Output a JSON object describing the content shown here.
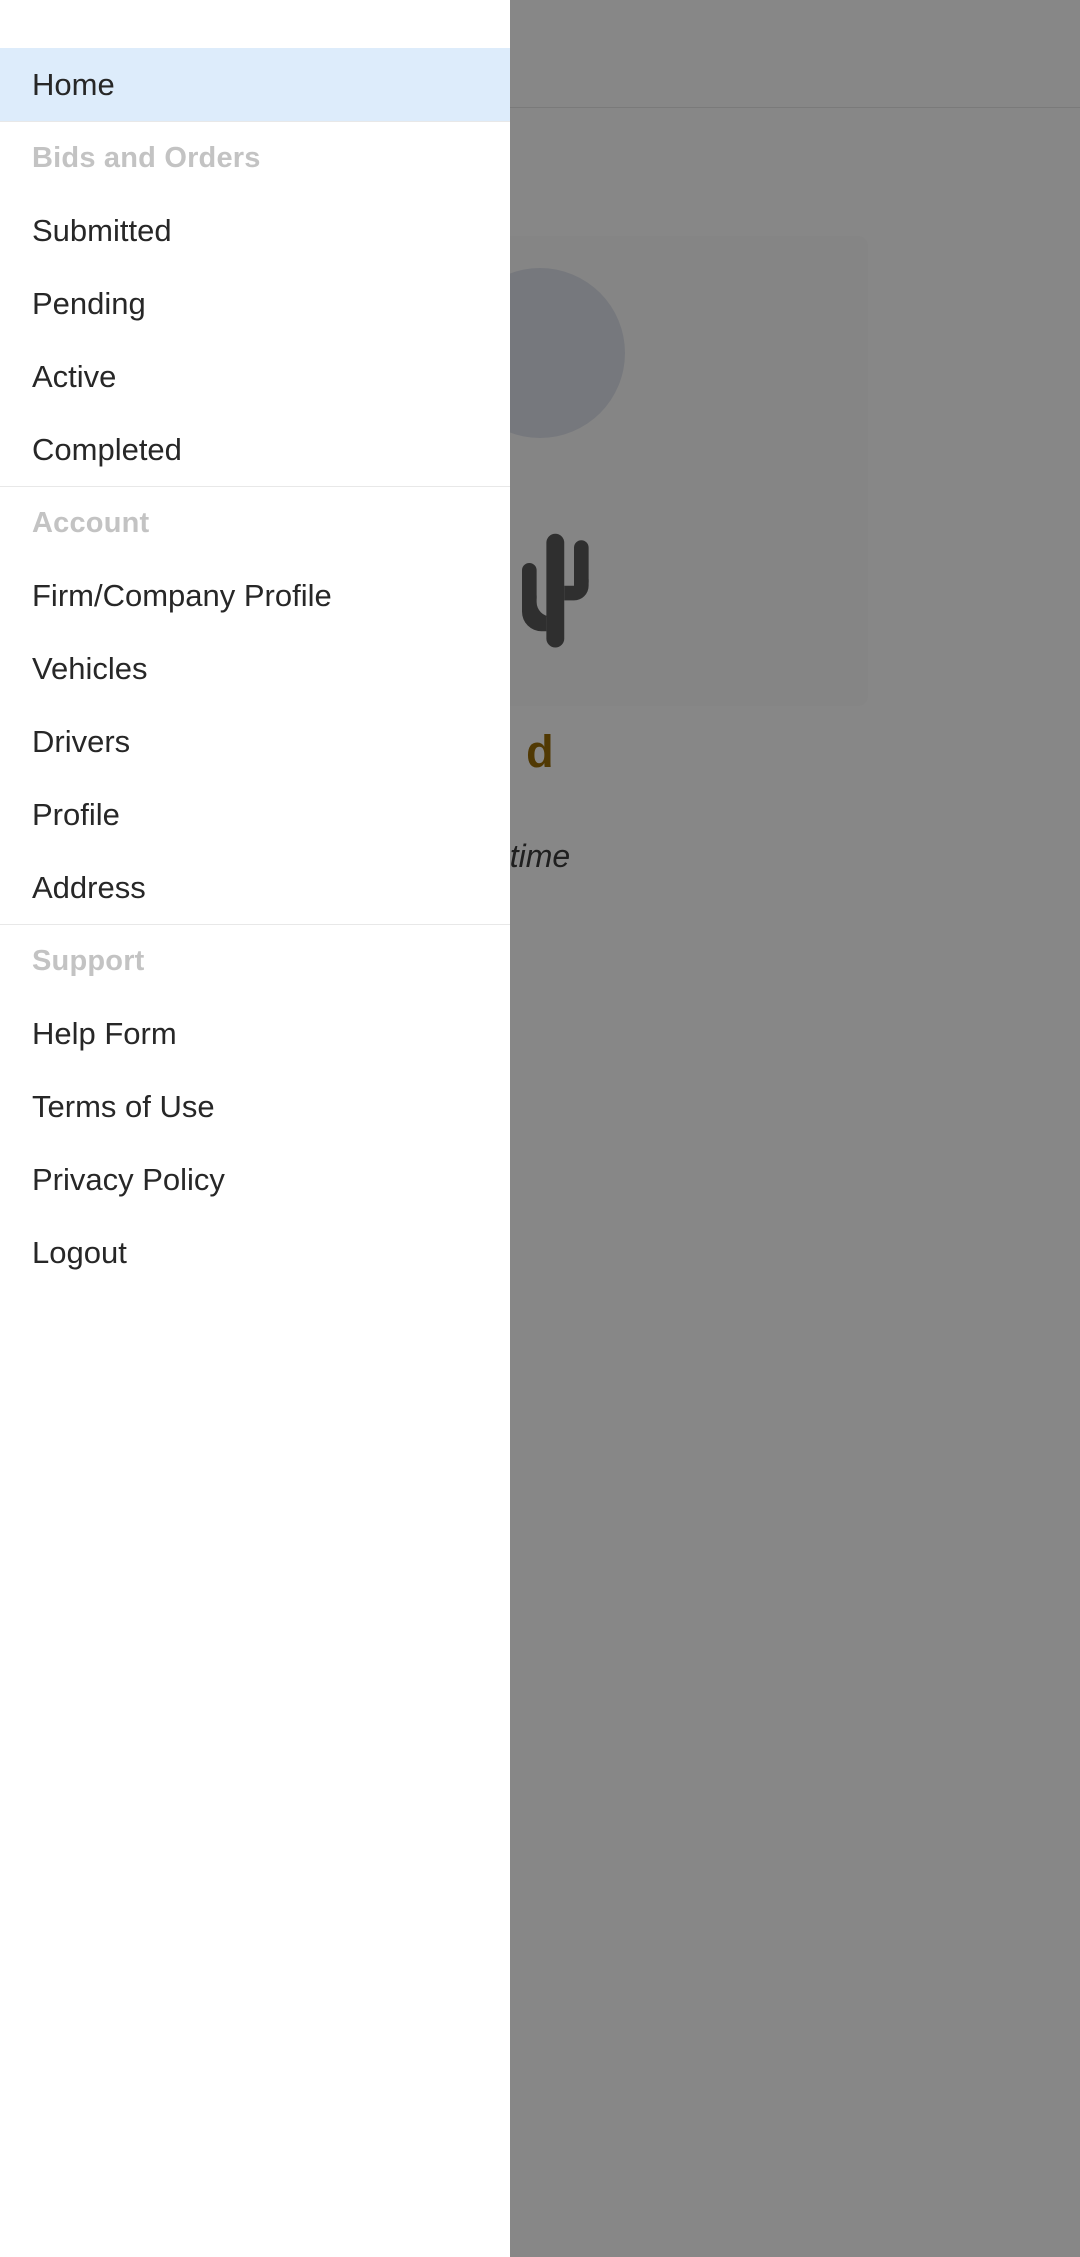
{
  "colors": {
    "active_item_background": "#ddecfb",
    "section_header_text": "#c3c3c3",
    "item_text": "#272727",
    "divider": "#e8e8e8",
    "drawer_background": "#ffffff",
    "scrim": "rgba(0,0,0,0.47)",
    "behind_heading_text": "#9a6d06",
    "behind_subtext": "#3c3c3c"
  },
  "drawer": {
    "primary": [
      {
        "label": "Home",
        "name": "home",
        "active": true
      }
    ],
    "sections": [
      {
        "title": "Bids and Orders",
        "name": "bids-and-orders",
        "items": [
          {
            "label": "Submitted",
            "name": "submitted"
          },
          {
            "label": "Pending",
            "name": "pending"
          },
          {
            "label": "Active",
            "name": "active"
          },
          {
            "label": "Completed",
            "name": "completed"
          }
        ]
      },
      {
        "title": "Account",
        "name": "account",
        "items": [
          {
            "label": "Firm/Company Profile",
            "name": "firm-company-profile"
          },
          {
            "label": "Vehicles",
            "name": "vehicles"
          },
          {
            "label": "Drivers",
            "name": "drivers"
          },
          {
            "label": "Profile",
            "name": "profile"
          },
          {
            "label": "Address",
            "name": "address"
          }
        ]
      },
      {
        "title": "Support",
        "name": "support",
        "items": [
          {
            "label": "Help Form",
            "name": "help-form"
          },
          {
            "label": "Terms of Use",
            "name": "terms-of-use"
          },
          {
            "label": "Privacy Policy",
            "name": "privacy-policy"
          },
          {
            "label": "Logout",
            "name": "logout"
          }
        ]
      }
    ]
  },
  "behind": {
    "icon": "cactus-icon",
    "heading_visible_text": "d",
    "subtext_visible_text": "time"
  }
}
